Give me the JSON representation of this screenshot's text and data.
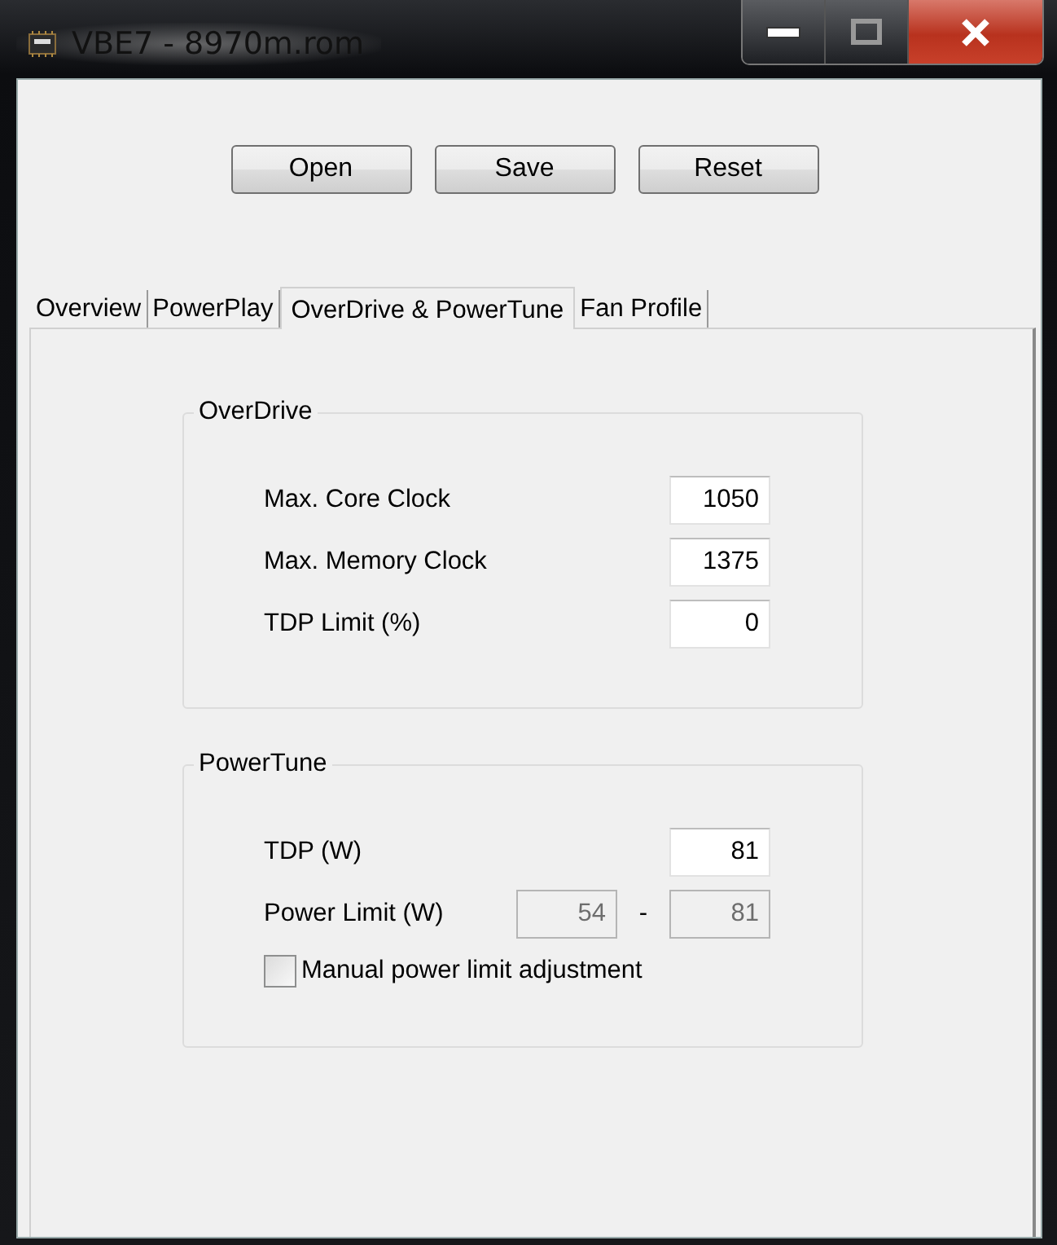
{
  "window": {
    "title": "VBE7 - 8970m.rom"
  },
  "buttons": [
    "Open",
    "Save",
    "Reset"
  ],
  "tabs": [
    {
      "label": "Overview",
      "selected": false
    },
    {
      "label": "PowerPlay",
      "selected": false
    },
    {
      "label": "OverDrive & PowerTune",
      "selected": true
    },
    {
      "label": "Fan Profile",
      "selected": false
    }
  ],
  "groups": [
    {
      "title": "OverDrive",
      "rows": [
        {
          "kind": "field",
          "label": "Max. Core Clock",
          "value": "1050"
        },
        {
          "kind": "field",
          "label": "Max. Memory Clock",
          "value": "1375"
        },
        {
          "kind": "field",
          "label": "TDP Limit (%)",
          "value": "0"
        }
      ]
    },
    {
      "title": "PowerTune",
      "rows": [
        {
          "kind": "field",
          "label": "TDP (W)",
          "value": "81"
        },
        {
          "kind": "range",
          "label": "Power Limit (W)",
          "min": "54",
          "separator": "-",
          "max": "81",
          "disabled": true
        },
        {
          "kind": "checkbox",
          "label": "Manual power limit adjustment",
          "checked": false
        }
      ]
    }
  ]
}
